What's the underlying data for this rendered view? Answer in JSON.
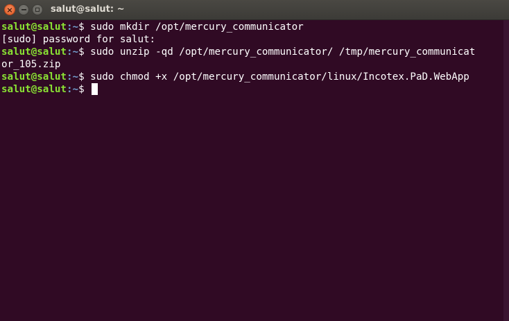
{
  "window": {
    "title": "salut@salut: ~",
    "close_glyph": "×"
  },
  "terminal": {
    "prompt_user": "salut@salut",
    "prompt_path": ":~",
    "prompt_symbol": "$ ",
    "lines": [
      {
        "type": "prompt",
        "command": "sudo mkdir /opt/mercury_communicator"
      },
      {
        "type": "output",
        "text": "[sudo] password for salut:"
      },
      {
        "type": "prompt",
        "command": "sudo unzip -qd /opt/mercury_communicator/ /tmp/mercury_communicat"
      },
      {
        "type": "output",
        "text": "or_105.zip"
      },
      {
        "type": "prompt",
        "command": "sudo chmod +x /opt/mercury_communicator/linux/Incotex.PaD.WebApp"
      },
      {
        "type": "prompt",
        "command": ""
      }
    ]
  },
  "colors": {
    "background": "#300a24",
    "prompt_user": "#8ae234",
    "prompt_path": "#729fcf",
    "text": "#ffffff"
  }
}
